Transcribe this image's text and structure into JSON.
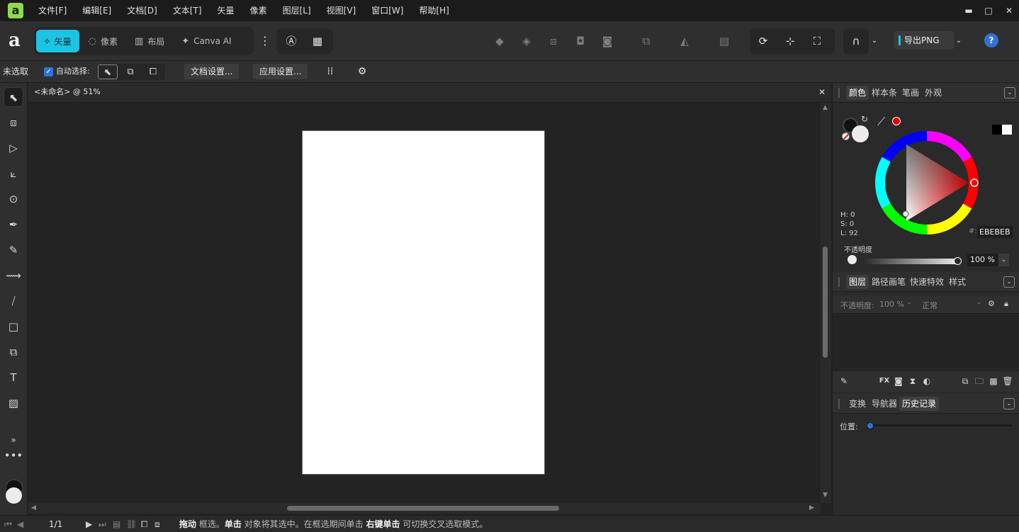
{
  "menubar": {
    "items": [
      "文件[F]",
      "编辑[E]",
      "文档[D]",
      "文本[T]",
      "矢量",
      "像素",
      "图层[L]",
      "视图[V]",
      "窗口[W]",
      "帮助[H]"
    ],
    "app_logo": "a",
    "controls": {
      "minimize": "▬",
      "maximize": "□",
      "close": "✕"
    }
  },
  "toolbar": {
    "brand": "a",
    "personas": [
      {
        "label": "矢量",
        "icon": "vector-persona-icon",
        "active": true
      },
      {
        "label": "像素",
        "icon": "pixel-persona-icon",
        "active": false
      },
      {
        "label": "布局",
        "icon": "layout-persona-icon",
        "active": false
      },
      {
        "label": "Canva AI",
        "icon": "sparkle-icon",
        "active": false
      }
    ],
    "export_label": "导出PNG"
  },
  "contextbar": {
    "selection_label": "未选取",
    "auto_select_label": "自动选择:",
    "doc_settings": "文档设置...",
    "app_settings": "应用设置..."
  },
  "document": {
    "tab_title": "<未命名> @ 51%",
    "close": "✕"
  },
  "statusbar": {
    "page": "1/1",
    "hint_bold_1": "拖动",
    "hint_1": " 框选。",
    "hint_bold_2": "单击",
    "hint_2": " 对象将其选中。在框选期间单击 ",
    "hint_bold_3": "右键单击",
    "hint_3": " 可切换交叉选取模式。"
  },
  "color_panel": {
    "tabs": [
      "颜色",
      "样本条",
      "笔画",
      "外观"
    ],
    "h": "H: 0",
    "s": "S: 0",
    "l": "L: 92",
    "hex_label": "#:",
    "hex": "EBEBEB",
    "opacity_label": "不透明度",
    "opacity_value": "100 %",
    "fill_color": "#ebebeb",
    "stroke_color": "#111111",
    "picked_color": "#e00000"
  },
  "layers_panel": {
    "tabs": [
      "图层",
      "路径画笔",
      "快速特效",
      "样式"
    ],
    "opacity_label": "不透明度:",
    "opacity_value": "100 %",
    "blend_mode": "正常"
  },
  "history_panel": {
    "tabs": [
      "变换",
      "导航器",
      "历史记录"
    ],
    "position_label": "位置:",
    "position": 0
  }
}
